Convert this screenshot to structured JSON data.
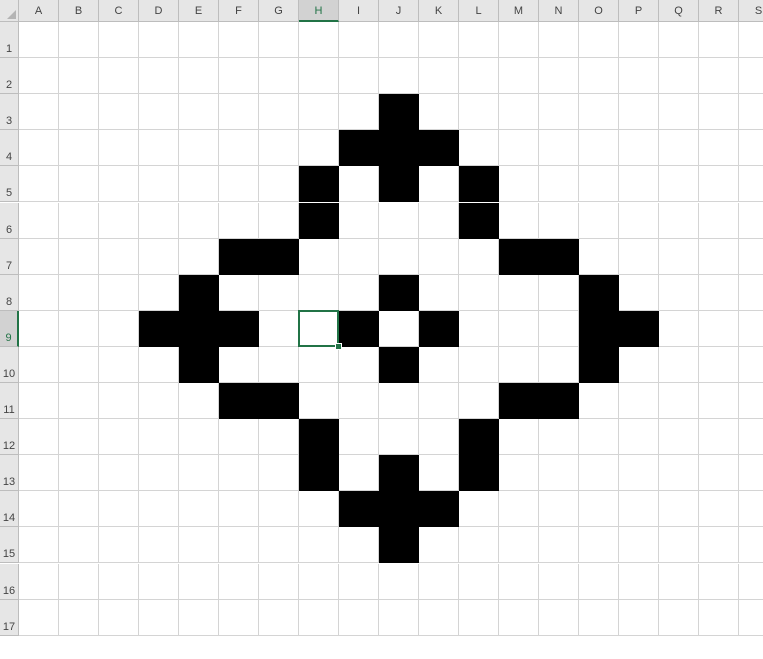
{
  "columns": [
    "A",
    "B",
    "C",
    "D",
    "E",
    "F",
    "G",
    "H",
    "I",
    "J",
    "K",
    "L",
    "M",
    "N",
    "O",
    "P",
    "Q",
    "R",
    "S"
  ],
  "rows": [
    "1",
    "2",
    "3",
    "4",
    "5",
    "6",
    "7",
    "8",
    "9",
    "10",
    "11",
    "12",
    "13",
    "14",
    "15",
    "16",
    "17"
  ],
  "active_cell": {
    "column": "H",
    "row": "9"
  },
  "filled_cells": [
    "J3",
    "I4",
    "J4",
    "K4",
    "H5",
    "J5",
    "L5",
    "H6",
    "L6",
    "F7",
    "G7",
    "M7",
    "N7",
    "E8",
    "J8",
    "O8",
    "D9",
    "E9",
    "F9",
    "I9",
    "K9",
    "O9",
    "P9",
    "E10",
    "J10",
    "O10",
    "F11",
    "G11",
    "M11",
    "N11",
    "H12",
    "L12",
    "H13",
    "J13",
    "L13",
    "I14",
    "J14",
    "K14",
    "J15"
  ],
  "colors": {
    "fill": "#000000",
    "grid": "#d4d4d4",
    "header_bg": "#e6e6e6",
    "header_text": "#444444",
    "selection": "#217346"
  }
}
